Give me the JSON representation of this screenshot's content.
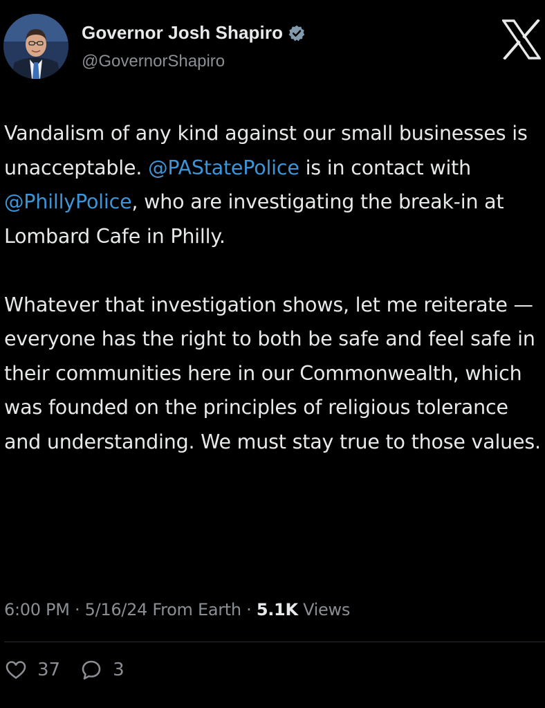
{
  "tweet": {
    "author": {
      "display_name": "Governor Josh Shapiro",
      "handle": "@GovernorShapiro",
      "verified_badge_color": "#829aab",
      "avatar_icon": "profile-photo"
    },
    "platform_logo": "x-logo",
    "paragraphs": [
      {
        "segments": [
          {
            "text": "Vandalism of any kind against our small businesses is unacceptable. ",
            "type": "text"
          },
          {
            "text": "@PAStatePolice",
            "type": "mention"
          },
          {
            "text": " is in contact with ",
            "type": "text"
          },
          {
            "text": "@PhillyPolice",
            "type": "mention"
          },
          {
            "text": ", who are investigating the break-in at Lombard Cafe in Philly.",
            "type": "text"
          }
        ]
      },
      {
        "segments": [
          {
            "text": "Whatever that investigation shows, let me reiterate — everyone has the right to both be safe and feel safe in their communities here in our Commonwealth, which was founded on the principles of religious tolerance and understanding. We must stay true to those values.",
            "type": "text"
          }
        ]
      }
    ],
    "meta": {
      "time": "6:00 PM",
      "separator": " · ",
      "date": "5/16/24",
      "source": "From Earth",
      "views_count": "5.1K",
      "views_label": "Views"
    },
    "actions": {
      "likes": "37",
      "replies": "3"
    },
    "colors": {
      "background": "#000000",
      "text": "#e7e9ea",
      "secondary": "#8b8f94",
      "mention": "#3c95d8"
    }
  }
}
